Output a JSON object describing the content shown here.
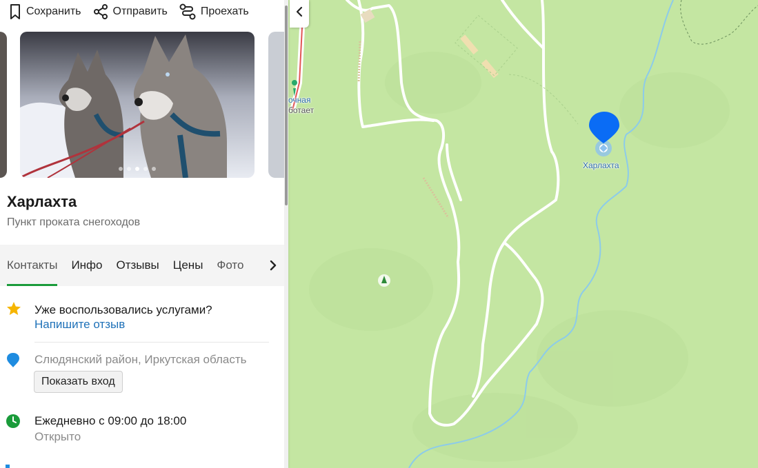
{
  "toolbar": {
    "save": "Сохранить",
    "share": "Отправить",
    "route": "Проехать"
  },
  "gallery": {
    "dots_total": 5,
    "active_dot": 3
  },
  "place": {
    "name": "Харлахта",
    "category": "Пункт проката снегоходов"
  },
  "tabs": [
    {
      "label": "Контакты"
    },
    {
      "label": "Инфо"
    },
    {
      "label": "Отзывы"
    },
    {
      "label": "Цены"
    },
    {
      "label": "Фото"
    }
  ],
  "review_prompt": {
    "question": "Уже воспользовались услугами?",
    "link": "Напишите отзыв"
  },
  "address": {
    "text": "Слюдянский район, Иркутская область",
    "button": "Показать вход"
  },
  "hours": {
    "schedule": "Ежедневно с 09:00 до 18:00",
    "status": "Открыто"
  },
  "map": {
    "marker_label": "Харлахта",
    "cut_label_line1": "очная",
    "cut_label_line2": "ботает",
    "marker_color": "#0a6cf5",
    "land_color": "#c4e6a2",
    "river_color": "#8ccbea"
  },
  "colors": {
    "accent": "#1a9b3a",
    "link": "#1e71b8",
    "star": "#f6b500",
    "hours_icon": "#1a9b3a",
    "pin_icon": "#1e8ce0"
  }
}
